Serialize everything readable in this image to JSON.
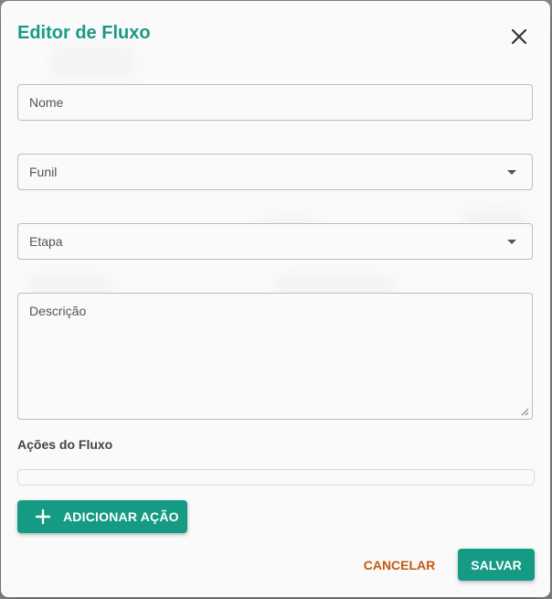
{
  "dialog": {
    "title": "Editor de Fluxo",
    "close_icon": "close-icon"
  },
  "form": {
    "name_placeholder": "Nome",
    "funnel_placeholder": "Funil",
    "stage_placeholder": "Etapa",
    "description_placeholder": "Descrição",
    "dropdown_icon": "chevron-down-icon"
  },
  "actions": {
    "section_label": "Ações do Fluxo",
    "add_label": "ADICIONAR AÇÃO",
    "add_icon": "plus-icon"
  },
  "footer": {
    "cancel_label": "CANCELAR",
    "save_label": "SALVAR"
  },
  "colors": {
    "accent": "#159a84",
    "title": "#1a9a84",
    "cancel": "#c45a10"
  }
}
